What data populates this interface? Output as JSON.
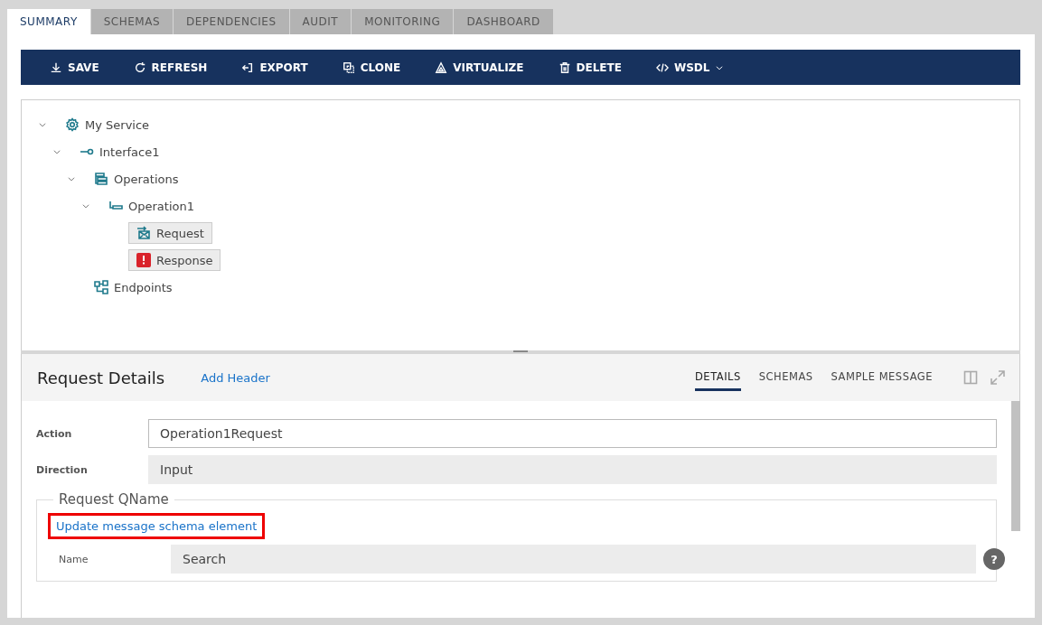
{
  "tabs": [
    {
      "label": "SUMMARY",
      "selected": true
    },
    {
      "label": "SCHEMAS",
      "selected": false
    },
    {
      "label": "DEPENDENCIES",
      "selected": false
    },
    {
      "label": "AUDIT",
      "selected": false
    },
    {
      "label": "MONITORING",
      "selected": false
    },
    {
      "label": "DASHBOARD",
      "selected": false
    }
  ],
  "toolbar": [
    {
      "kind": "save",
      "label": "SAVE"
    },
    {
      "kind": "refresh",
      "label": "REFRESH"
    },
    {
      "kind": "export",
      "label": "EXPORT"
    },
    {
      "kind": "clone",
      "label": "CLONE"
    },
    {
      "kind": "virtualize",
      "label": "VIRTUALIZE"
    },
    {
      "kind": "delete",
      "label": "DELETE"
    },
    {
      "kind": "wsdl",
      "label": "WSDL",
      "dropdown": true
    }
  ],
  "tree": [
    {
      "kind": "service",
      "label": "My Service",
      "expanded": true,
      "children": [
        {
          "kind": "interface",
          "label": "Interface1",
          "expanded": true,
          "children": [
            {
              "kind": "operations",
              "label": "Operations",
              "expanded": true,
              "children": [
                {
                  "kind": "operation",
                  "label": "Operation1",
                  "expanded": true,
                  "children": [
                    {
                      "kind": "request",
                      "label": "Request"
                    },
                    {
                      "kind": "response",
                      "label": "Response"
                    }
                  ]
                }
              ]
            },
            {
              "kind": "endpoints",
              "label": "Endpoints"
            }
          ]
        }
      ]
    }
  ],
  "details": {
    "title": "Request Details",
    "link": "Add Header",
    "tabs": [
      {
        "label": "DETAILS",
        "selected": true
      },
      {
        "label": "SCHEMAS",
        "selected": false
      },
      {
        "label": "SAMPLE MESSAGE",
        "selected": false
      }
    ],
    "fields": [
      {
        "label": "Action",
        "value": "Operation1Request",
        "kind": "input"
      },
      {
        "label": "Direction",
        "value": "Input",
        "kind": "readonly"
      }
    ],
    "group": {
      "legend": "Request QName",
      "link": "Update message schema element",
      "highlighted": true,
      "fields": [
        {
          "label": "Name",
          "value": "Search",
          "kind": "readonly"
        }
      ],
      "help": "?"
    }
  }
}
